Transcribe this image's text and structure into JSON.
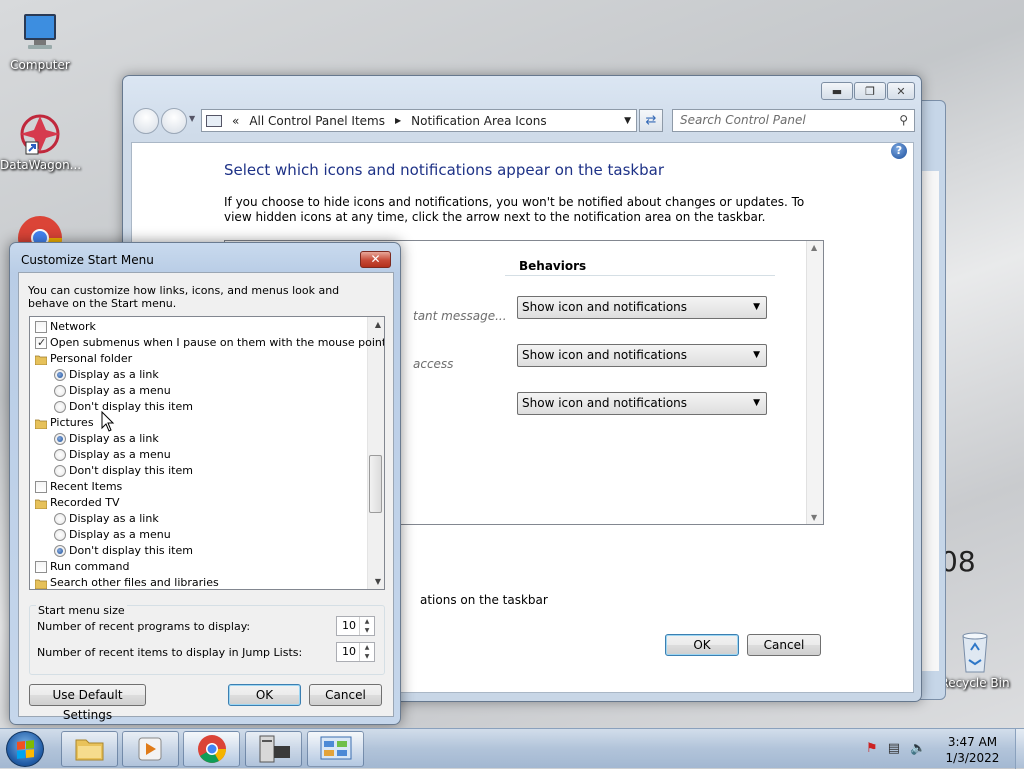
{
  "desktop": {
    "icons": [
      {
        "label": "Computer"
      },
      {
        "label": "DataWagon..."
      },
      {
        "label": "Recycle Bin"
      }
    ],
    "partial_text": "08"
  },
  "control_panel": {
    "breadcrumb_prefix": "«",
    "breadcrumb": [
      "All Control Panel Items",
      "Notification Area Icons"
    ],
    "search_placeholder": "Search Control Panel",
    "heading": "Select which icons and notifications appear on the taskbar",
    "description": "If you choose to hide icons and notifications, you won't be notified about changes or updates. To view hidden icons at any time, click the arrow next to the notification area on the taskbar.",
    "behaviors_header": "Behaviors",
    "partial_rows": [
      "tant message...",
      "access"
    ],
    "behavior_values": [
      "Show icon and notifications",
      "Show icon and notifications",
      "Show icon and notifications"
    ],
    "footer_partial": "ations on the taskbar",
    "ok_label": "OK",
    "cancel_label": "Cancel"
  },
  "customize_dialog": {
    "title": "Customize Start Menu",
    "intro": "You can customize how links, icons, and menus look and behave on the Start menu.",
    "items": [
      {
        "kind": "check",
        "label": "Network",
        "checked": false,
        "indent": 0
      },
      {
        "kind": "check",
        "label": "Open submenus when I pause on them with the mouse pointer",
        "checked": true,
        "indent": 0
      },
      {
        "kind": "folder",
        "label": "Personal folder",
        "indent": 0
      },
      {
        "kind": "radio",
        "label": "Display as a link",
        "checked": true,
        "indent": 1
      },
      {
        "kind": "radio",
        "label": "Display as a menu",
        "checked": false,
        "indent": 1
      },
      {
        "kind": "radio",
        "label": "Don't display this item",
        "checked": false,
        "indent": 1
      },
      {
        "kind": "folder",
        "label": "Pictures",
        "indent": 0
      },
      {
        "kind": "radio",
        "label": "Display as a link",
        "checked": true,
        "indent": 1
      },
      {
        "kind": "radio",
        "label": "Display as a menu",
        "checked": false,
        "indent": 1
      },
      {
        "kind": "radio",
        "label": "Don't display this item",
        "checked": false,
        "indent": 1
      },
      {
        "kind": "check",
        "label": "Recent Items",
        "checked": false,
        "indent": 0
      },
      {
        "kind": "folder",
        "label": "Recorded TV",
        "indent": 0
      },
      {
        "kind": "radio",
        "label": "Display as a link",
        "checked": false,
        "indent": 1
      },
      {
        "kind": "radio",
        "label": "Display as a menu",
        "checked": false,
        "indent": 1
      },
      {
        "kind": "radio",
        "label": "Don't display this item",
        "checked": true,
        "indent": 1
      },
      {
        "kind": "check",
        "label": "Run command",
        "checked": false,
        "indent": 0
      },
      {
        "kind": "folder",
        "label": "Search other files and libraries",
        "indent": 0
      }
    ],
    "size_group_label": "Start menu size",
    "recent_programs_label": "Number of recent programs to display:",
    "recent_programs_value": "10",
    "recent_items_label": "Number of recent items to display in Jump Lists:",
    "recent_items_value": "10",
    "default_button": "Use Default Settings",
    "ok_label": "OK",
    "cancel_label": "Cancel"
  },
  "taskbar": {
    "apps": [
      "file-explorer",
      "media-player",
      "chrome",
      "system-info",
      "control-panel"
    ],
    "time": "3:47 AM",
    "date": "1/3/2022"
  }
}
